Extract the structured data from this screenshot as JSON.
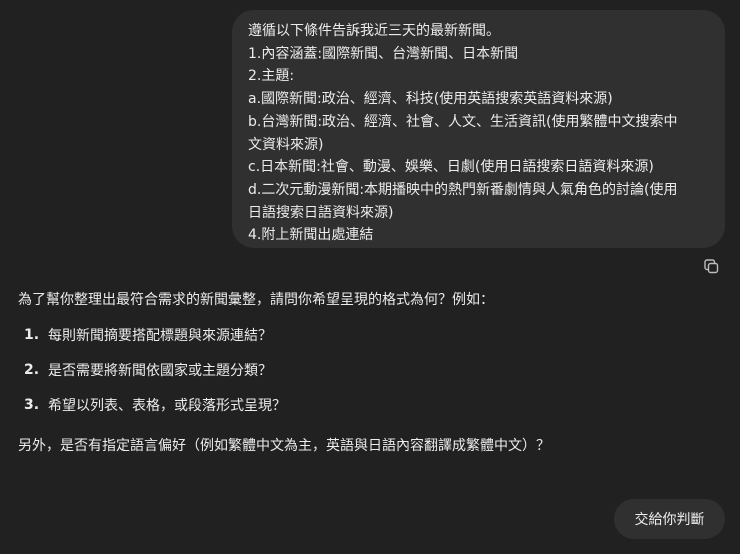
{
  "user_message": {
    "lines": [
      "遵循以下條件告訴我近三天的最新新聞。",
      "1.內容涵蓋:國際新聞、台灣新聞、日本新聞",
      "2.主題:",
      "a.國際新聞:政治、經濟、科技(使用英語搜索英語資料來源)",
      "b.台灣新聞:政治、經濟、社會、人文、生活資訊(使用繁體中文搜索中",
      "文資料來源)",
      "c.日本新聞:社會、動漫、娛樂、日劇(使用日語搜索日語資料來源)",
      "d.二次元動漫新聞:本期播映中的熱門新番劇情與人氣角色的討論(使用",
      "日語搜索日語資料來源)",
      "4.附上新聞出處連結"
    ]
  },
  "copy_icon": "copy-icon",
  "assistant_message": {
    "intro": "為了幫你整理出最符合需求的新聞彙整，請問你希望呈現的格式為何？例如：",
    "items": [
      {
        "num": "1.",
        "text": "每則新聞摘要搭配標題與來源連結？"
      },
      {
        "num": "2.",
        "text": "是否需要將新聞依國家或主題分類？"
      },
      {
        "num": "3.",
        "text": "希望以列表、表格，或段落形式呈現？"
      }
    ],
    "closing": "另外，是否有指定語言偏好（例如繁體中文為主，英語與日語內容翻譯成繁體中文）？"
  },
  "suggestion_button": "交給你判斷",
  "colors": {
    "background": "#212121",
    "bubble": "#303030",
    "text": "#ececec"
  }
}
